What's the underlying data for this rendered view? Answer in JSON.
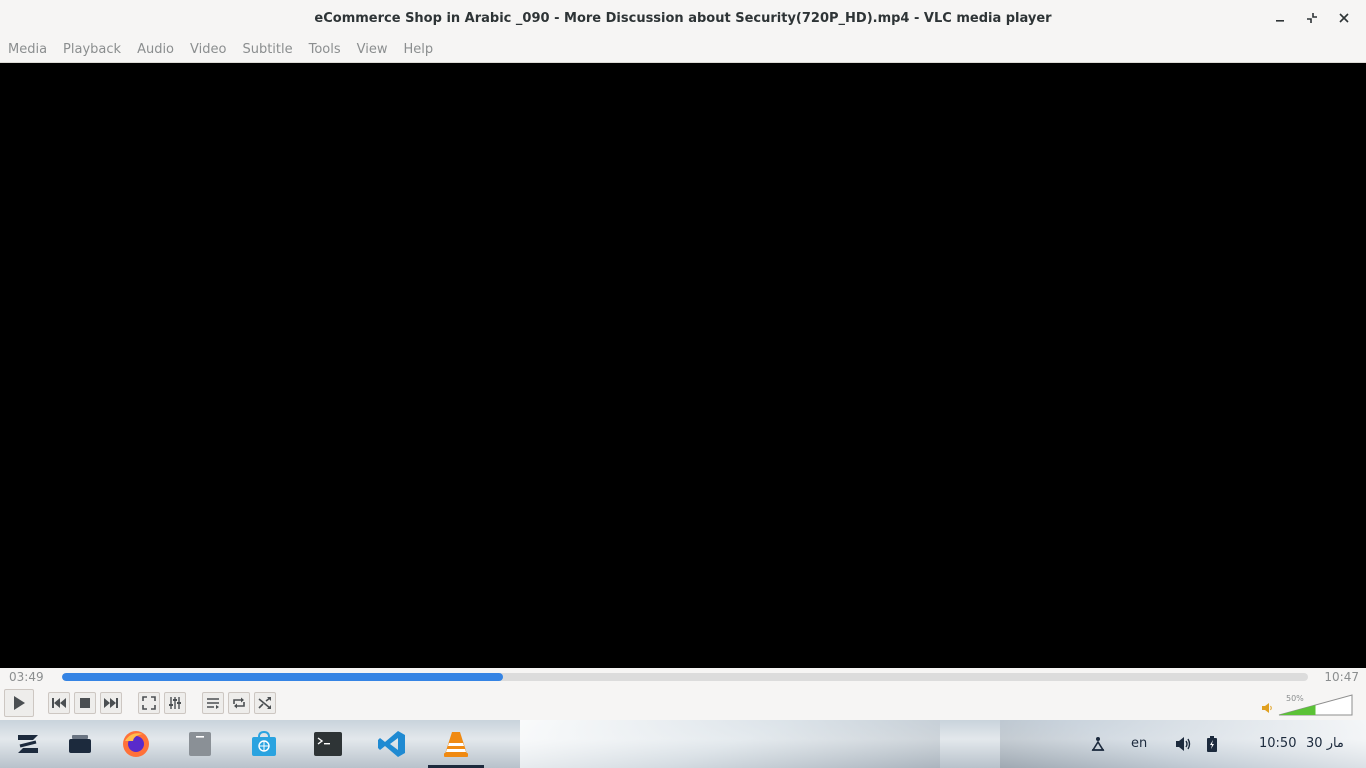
{
  "window": {
    "title": "eCommerce Shop in Arabic _090 - More Discussion about Security(720P_HD).mp4 - VLC media player",
    "minimize_glyph": "–",
    "maximize_glyph": "⤡",
    "close_glyph": "✕"
  },
  "menubar": {
    "items": [
      {
        "label": "Media"
      },
      {
        "label": "Playback"
      },
      {
        "label": "Audio"
      },
      {
        "label": "Video"
      },
      {
        "label": "Subtitle"
      },
      {
        "label": "Tools"
      },
      {
        "label": "View"
      },
      {
        "label": "Help"
      }
    ]
  },
  "playback": {
    "elapsed": "03:49",
    "total": "10:47",
    "progress_fraction": 0.354,
    "volume_label": "50%",
    "volume_fraction": 0.5
  },
  "colors": {
    "accent": "#3584e4",
    "volume_green": "#5bc236",
    "vlc_orange": "#f08a12",
    "vscode_blue": "#1f8ad2",
    "store_blue": "#2aa3e0"
  },
  "taskbar": {
    "apps": [
      {
        "icon": "zorin-menu-icon"
      },
      {
        "icon": "workspace-icon"
      },
      {
        "icon": "firefox-icon"
      },
      {
        "icon": "files-icon"
      },
      {
        "icon": "software-store-icon"
      },
      {
        "icon": "terminal-icon"
      },
      {
        "icon": "vscode-icon"
      },
      {
        "icon": "vlc-icon"
      }
    ],
    "tray": {
      "keyboard_layout": "en",
      "clock": "10:50",
      "date": "30 مار"
    }
  }
}
